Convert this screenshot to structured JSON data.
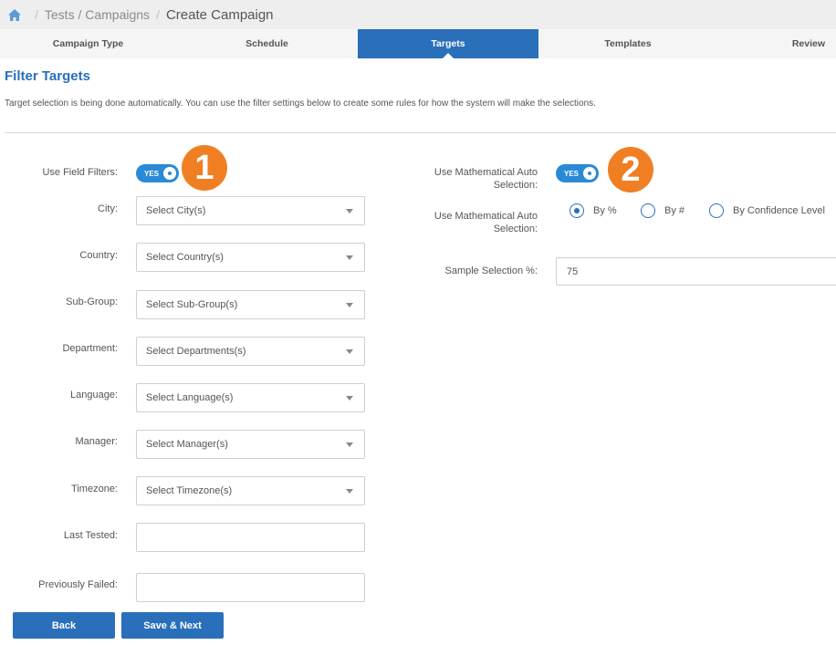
{
  "breadcrumb": {
    "crumb1": "Tests / Campaigns",
    "separator": "/",
    "current": "Create Campaign"
  },
  "tabs": [
    {
      "label": "Campaign Type"
    },
    {
      "label": "Schedule"
    },
    {
      "label": "Targets"
    },
    {
      "label": "Templates"
    },
    {
      "label": "Review"
    }
  ],
  "section": {
    "title": "Filter Targets",
    "intro": "Target selection is being done automatically. You can use the filter settings below to create some rules for how the system will make the selections."
  },
  "left": {
    "field_filters_label": "Use Field Filters:",
    "field_filters_toggle": "YES",
    "badge1": "1",
    "fields": [
      {
        "label": "City:",
        "placeholder": "Select City(s)"
      },
      {
        "label": "Country:",
        "placeholder": "Select Country(s)"
      },
      {
        "label": "Sub-Group:",
        "placeholder": "Select Sub-Group(s)"
      },
      {
        "label": "Department:",
        "placeholder": "Select Departments(s)"
      },
      {
        "label": "Language:",
        "placeholder": "Select Language(s)"
      },
      {
        "label": "Manager:",
        "placeholder": "Select Manager(s)"
      },
      {
        "label": "Timezone:",
        "placeholder": "Select Timezone(s)"
      }
    ],
    "last_tested_label": "Last Tested:",
    "previously_failed_label": "Previously Failed:"
  },
  "right": {
    "auto_label_line1": "Use Mathematical Auto",
    "auto_label_line2": "Selection:",
    "auto_toggle": "YES",
    "badge2": "2",
    "mode_label_line1": "Use Mathematical Auto",
    "mode_label_line2": "Selection:",
    "radio_options": [
      "By %",
      "By #",
      "By Confidence Level"
    ],
    "selected_option": "By %",
    "sample_label": "Sample Selection %:",
    "sample_value": "75"
  },
  "buttons": {
    "back": "Back",
    "save_next": "Save & Next"
  },
  "colors": {
    "primary": "#2a6fba",
    "toggle": "#2a8ad6",
    "badge": "#f07f23"
  },
  "icons": {
    "home": "home-icon",
    "caret": "chevron-down-icon"
  }
}
